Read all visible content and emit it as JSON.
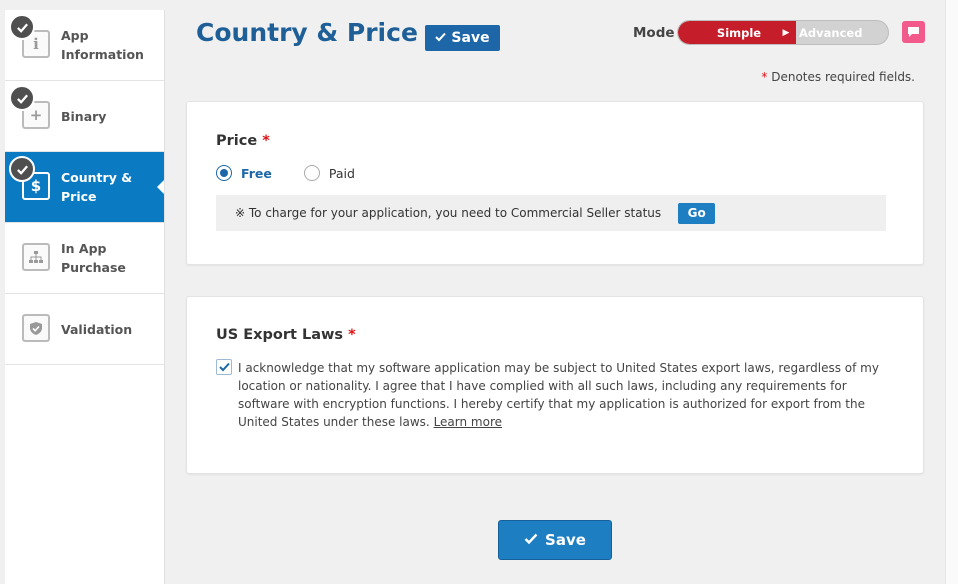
{
  "sidebar": {
    "items": [
      {
        "label": "App Information",
        "icon": "info-icon",
        "glyph": "i",
        "done": true,
        "active": false
      },
      {
        "label": "Binary",
        "icon": "plus-icon",
        "glyph": "+",
        "done": true,
        "active": false
      },
      {
        "label": "Country & Price",
        "icon": "dollar-icon",
        "glyph": "$",
        "done": true,
        "active": true
      },
      {
        "label": "In App Purchase",
        "icon": "hierarchy-icon",
        "glyph": "",
        "done": false,
        "active": false
      },
      {
        "label": "Validation",
        "icon": "shield-icon",
        "glyph": "",
        "done": false,
        "active": false
      }
    ]
  },
  "header": {
    "title": "Country & Price",
    "save_label": "Save",
    "mode_label": "Mode",
    "mode_simple": "Simple",
    "mode_advanced": "Advanced",
    "mode_selected": "Simple",
    "required_note": "Denotes required fields."
  },
  "price": {
    "heading": "Price",
    "options": [
      {
        "label": "Free",
        "selected": true
      },
      {
        "label": "Paid",
        "selected": false
      }
    ],
    "notice": "※ To charge for your application, you need to Commercial Seller status",
    "go_label": "Go"
  },
  "export": {
    "heading": "US Export Laws",
    "checked": true,
    "text": "I acknowledge that my software application may be subject to United States export laws, regardless of my location or nationality. I agree that I have complied with all such laws, including any requirements for software with encryption functions. I hereby certify that my application is authorized for export from the United States under these laws.",
    "learn_more": "Learn more"
  },
  "footer": {
    "save_label": "Save"
  },
  "colors": {
    "brand_blue": "#1d67a8",
    "active_blue": "#0a7bc2",
    "mode_red": "#c61d2a",
    "required_red": "#dd1111"
  }
}
